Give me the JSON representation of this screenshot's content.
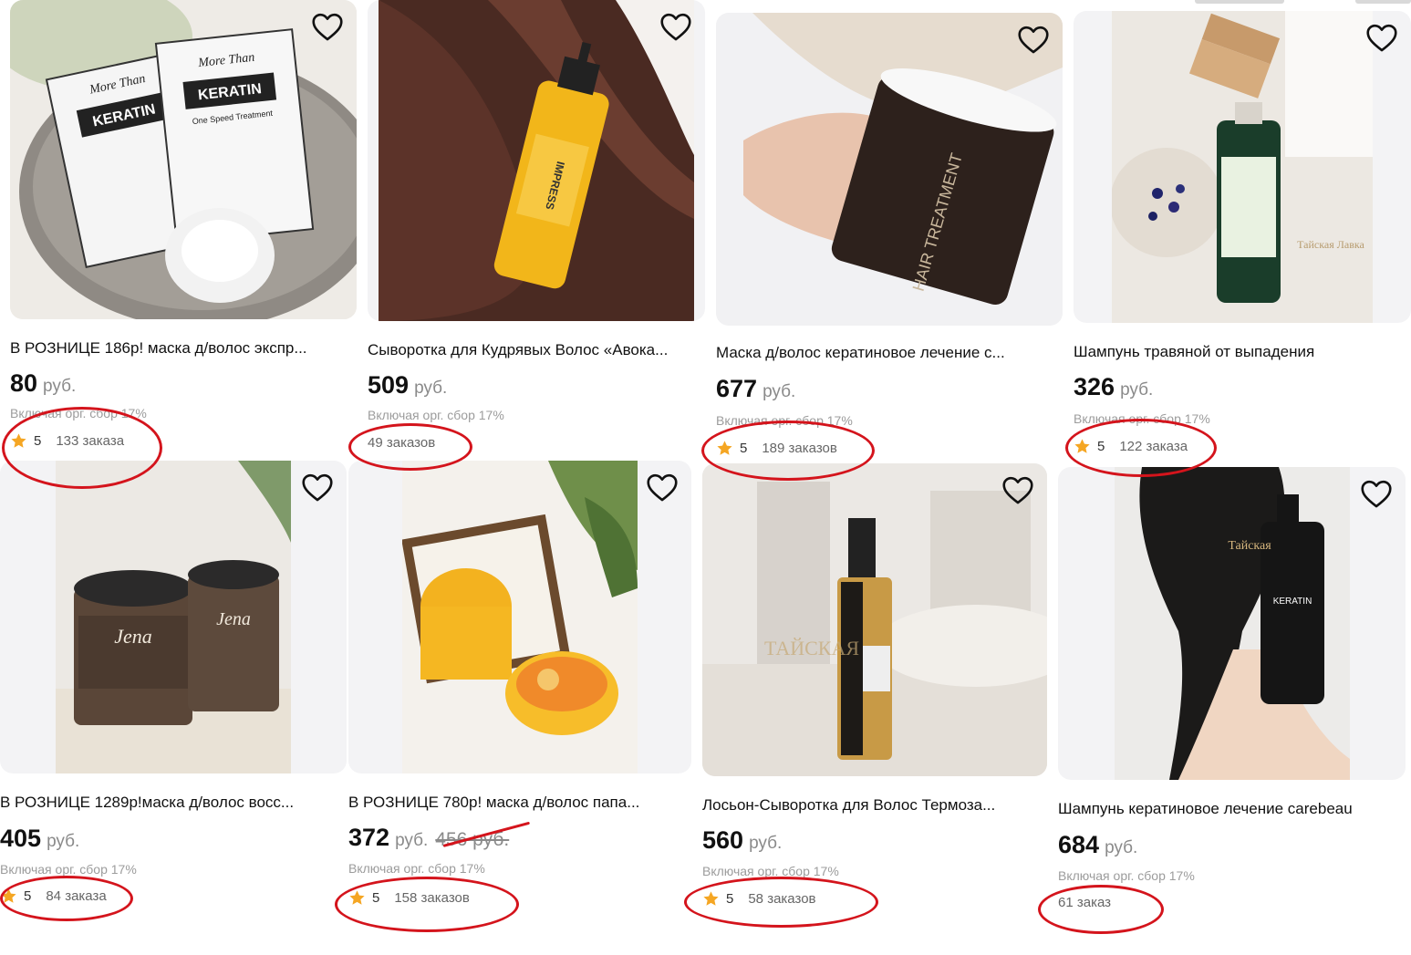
{
  "currency": "руб.",
  "fee_note": "Включая орг. сбор 17%",
  "colors": {
    "annotation": "#d4141c",
    "star": "#f5a623",
    "image_bg": "#f3f3f5"
  },
  "icons": {
    "favorite": "heart-outline-icon",
    "rating": "star-icon"
  },
  "products": [
    {
      "title": "В РОЗНИЦЕ 186р! маска д/волос экспр...",
      "price": "80",
      "rating": "5",
      "orders": "133 заказа"
    },
    {
      "title": "Сыворотка для Кудрявых Волос «Авока...",
      "price": "509",
      "rating": "",
      "orders": "49 заказов"
    },
    {
      "title": "Маска д/волос кератиновое лечение с...",
      "price": "677",
      "rating": "5",
      "orders": "189 заказов"
    },
    {
      "title": "Шампунь травяной от выпадения",
      "price": "326",
      "rating": "5",
      "orders": "122 заказа"
    },
    {
      "title": "В РОЗНИЦЕ 1289р!маска д/волос восс...",
      "price": "405",
      "rating": "5",
      "orders": "84 заказа"
    },
    {
      "title": "В РОЗНИЦЕ 780р! маска д/волос папа...",
      "price": "372",
      "old_price": "456 руб.",
      "rating": "5",
      "orders": "158 заказов"
    },
    {
      "title": "Лосьон-Сыворотка для Волос Термоза...",
      "price": "560",
      "rating": "5",
      "orders": "58 заказов"
    },
    {
      "title": "Шампунь кератиновое лечение carebeau",
      "price": "684",
      "rating": "",
      "orders": "61 заказ"
    }
  ]
}
